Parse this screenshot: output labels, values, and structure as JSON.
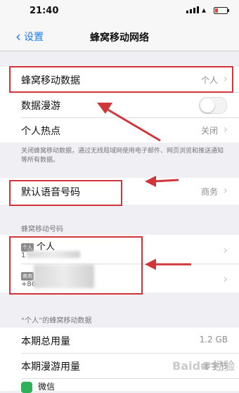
{
  "status_bar": {
    "time": "21:40"
  },
  "nav": {
    "back_label": "设置",
    "title": "蜂窝移动网络"
  },
  "group1": {
    "cellular_data_label": "蜂窝移动数据",
    "cellular_data_value": "个人",
    "roaming_label": "数据漫游",
    "roaming_enabled": false,
    "hotspot_label": "个人热点",
    "hotspot_value": "关闭"
  },
  "note": "关闭蜂窝移动数据，通过无线局域网使用电子邮件、网页浏览和推送通知等所有数据。",
  "voice": {
    "label": "默认语音号码",
    "value": "商务"
  },
  "numbers_header": "蜂窝移动号码",
  "numbers": [
    {
      "badge": "个人",
      "name": "个人",
      "number": "1"
    },
    {
      "badge": "商务",
      "name": "商务",
      "number": "+86"
    }
  ],
  "usage_header": "“个人”的蜂窝移动数据",
  "usage": {
    "total_label": "本期总用量",
    "total_value": "1.2 GB",
    "roaming_label": "本期漫游用量",
    "roaming_value": "零字节"
  },
  "next_row_label": "微信",
  "watermark": "Baidu 经验",
  "colors": {
    "accent": "#1f7cf0",
    "annotation": "#d0353a",
    "toggle_off": "#f3f3f3"
  }
}
